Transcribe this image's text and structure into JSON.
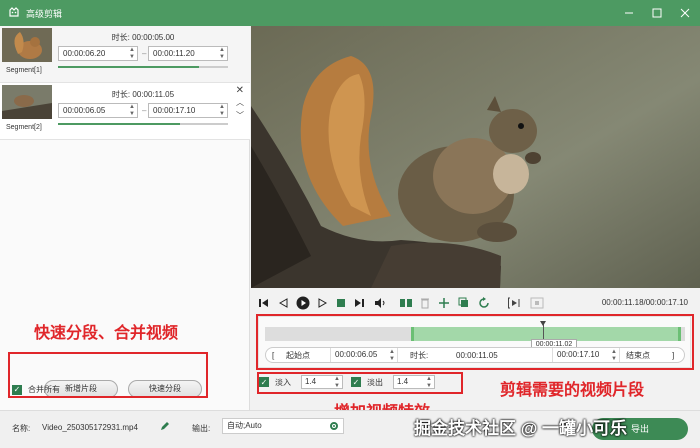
{
  "window": {
    "title": "高级剪辑"
  },
  "segments": [
    {
      "label": "Segment[1]",
      "duration_label": "时长:",
      "duration": "00:00:05.00",
      "start": "00:00:06.20",
      "end": "00:00:11.20",
      "progress": 0.83
    },
    {
      "label": "Segment[2]",
      "duration_label": "时长:",
      "duration": "00:00:11.05",
      "start": "00:00:06.05",
      "end": "00:00:17.10",
      "progress": 0.72
    }
  ],
  "player": {
    "time_display": "00:00:11.18/00:00:17.10"
  },
  "timeline": {
    "tooltip": "00:00:11.02",
    "start_btn": "起始点",
    "start_value": "00:00:06.05",
    "duration_label": "时长:",
    "duration_value": "00:00:11.05",
    "end_value": "00:00:17.10",
    "end_btn": "结束点"
  },
  "fade": {
    "in_label": "淡入",
    "in_value": "1.4",
    "out_label": "淡出",
    "out_value": "1.4",
    "in_checked": true,
    "out_checked": true
  },
  "left_buttons": {
    "add_segment": "新增片段",
    "quick_split": "快速分段",
    "merge_all": "合并所有",
    "merge_checked": true
  },
  "annotations": {
    "left": "快速分段、合并视频",
    "right": "剪辑需要的视频片段",
    "bottom": "增加视频特效"
  },
  "bottom": {
    "name_label": "名称:",
    "name_value": "Video_250305172931.mp4",
    "output_label": "输出:",
    "output_value": "自动;Auto",
    "export_btn": "导出"
  },
  "watermark": "掘金技术社区 @ 一罐小可乐",
  "colors": {
    "accent": "#4d9a62",
    "annotation": "#e0262a"
  }
}
